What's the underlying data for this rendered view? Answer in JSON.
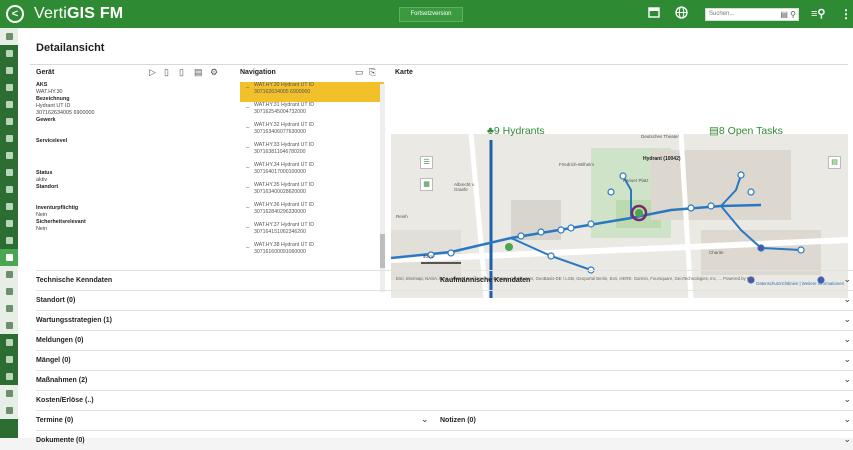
{
  "app": {
    "brand_light": "Verti",
    "brand_bold": "GIS FM",
    "version_button": "Fortsetzversion",
    "search_placeholder": "Suchen...",
    "icons": [
      "back-icon",
      "calendar-icon",
      "globe-icon",
      "search-icon",
      "filter-search-icon",
      "more-vert-icon"
    ]
  },
  "colors": {
    "brand_green": "#2f8a34",
    "selected_yellow": "#f2c02a",
    "network_blue": "#2b78c2"
  },
  "page_title": "Detailansicht",
  "geraet": {
    "title": "Gerät",
    "fields": [
      {
        "label": "AKS",
        "value": "WAT.HY.30"
      },
      {
        "label": "Bezeichnung",
        "value": "Hydrant UT ID 307162634005 6900000"
      },
      {
        "label": "Gewerk",
        "value": ""
      },
      {
        "label": "Servicelevel",
        "value": ""
      },
      {
        "label": "Status",
        "value": "aktiv"
      },
      {
        "label": "Standort",
        "value": ""
      },
      {
        "label": "Inventurpflichtig",
        "value": "Nein"
      },
      {
        "label": "Sicherheitsrelevant",
        "value": "Nein"
      }
    ]
  },
  "navigation": {
    "title": "Navigation",
    "items": [
      {
        "line1": "WAT.HY.30 Hydrant UT ID",
        "line2": "307162634005 6900000",
        "selected": true
      },
      {
        "line1": "WAT.HY.31 Hydrant UT ID",
        "line2": "307162545004732000",
        "selected": false
      },
      {
        "line1": "WAT.HY.32 Hydrant UT ID",
        "line2": "307163406077630000",
        "selected": false
      },
      {
        "line1": "WAT.HY.33 Hydrant UT ID",
        "line2": "307163811046780200",
        "selected": false
      },
      {
        "line1": "WAT.HY.34 Hydrant UT ID",
        "line2": "307164017000100000",
        "selected": false
      },
      {
        "line1": "WAT.HY.35 Hydrant UT ID",
        "line2": "307163400028620000",
        "selected": false
      },
      {
        "line1": "WAT.HY.36 Hydrant UT ID",
        "line2": "307162840296330000",
        "selected": false
      },
      {
        "line1": "WAT.HY.37 Hydrant UT ID",
        "line2": "307164151062346200",
        "selected": false
      },
      {
        "line1": "WAT.HY.38 Hydrant UT ID",
        "line2": "307161600091060000",
        "selected": false
      }
    ]
  },
  "karte": {
    "title": "Karte",
    "hydrants": "9 Hydrants",
    "open_tasks": "8 Open Tasks",
    "hydrant_label": "Hydrant (10042)",
    "place_labels": [
      "Deutsches Theater",
      "Albrecht v. Graefe",
      "Friedrich-Wilhelm",
      "Pariser Platz",
      "Charite",
      "Reinh"
    ],
    "scale": "40 m",
    "attribution": "Esri, Intermap, NASA, NGA, USGS | Esri Community Maps Contributors, GeoBasis-DE / LGB, Geoportal Berlin, Esri, HERE, Garmin, Foursquare, GeoTechnologies, Inc, ... Powered by Esri",
    "links": "Datenschutzrichtlinien | Weitere Informationen"
  },
  "sections": [
    {
      "left": "Technische Kenndaten",
      "right": "Kaufmännische Kenndaten"
    },
    {
      "left": "Standort (0)",
      "right": ""
    },
    {
      "left": "Wartungsstrategien (1)",
      "right": ""
    },
    {
      "left": "Meldungen (0)",
      "right": ""
    },
    {
      "left": "Mängel (0)",
      "right": ""
    },
    {
      "left": "Maßnahmen (2)",
      "right": ""
    },
    {
      "left": "Kosten/Erlöse (..)",
      "right": ""
    },
    {
      "left": "Termine (0)",
      "right": "Notizen (0)"
    },
    {
      "left": "Dokumente (0)",
      "right": ""
    }
  ]
}
